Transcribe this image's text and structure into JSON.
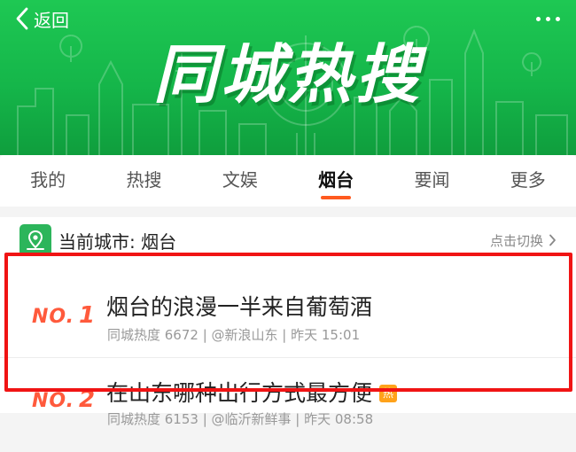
{
  "header": {
    "back_label": "返回",
    "back_icon": "chevron-left-icon",
    "more_icon": "more-dots-icon",
    "banner_title": "同城热搜",
    "banner_color": "#1ec853"
  },
  "tabs": [
    {
      "label": "我的"
    },
    {
      "label": "热搜"
    },
    {
      "label": "文娱"
    },
    {
      "label": "烟台",
      "active": true
    },
    {
      "label": "要闻"
    },
    {
      "label": "更多"
    }
  ],
  "city": {
    "icon": "location-pin-icon",
    "label": "当前城市: 烟台",
    "switch_label": "点击切换"
  },
  "news": [
    {
      "rank_prefix": "NO.",
      "rank": "1",
      "title": "烟台的浪漫一半来自葡萄酒",
      "meta": "同城热度 6672 | @新浪山东 | 昨天 15:01"
    },
    {
      "rank_prefix": "NO.",
      "rank": "2",
      "title": "在山东哪种出行方式最方便",
      "badge": "热",
      "meta": "同城热度 6153 | @临沂新鲜事 | 昨天 08:58"
    }
  ],
  "colors": {
    "accent": "#ff5a1f",
    "rank": "#ff5a3c",
    "highlight_frame": "#f01414",
    "badge": "#ffa21a"
  }
}
